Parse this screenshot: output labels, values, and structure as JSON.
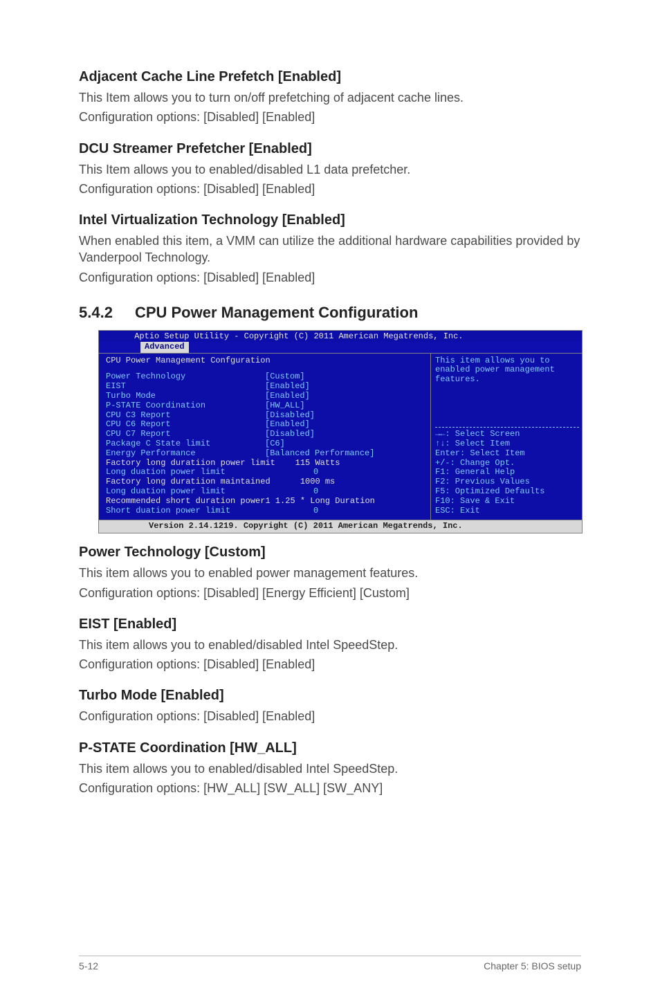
{
  "sections": {
    "adjacent": {
      "title": "Adjacent Cache Line Prefetch [Enabled]",
      "text1": "This Item allows you to turn on/off prefetching of adjacent cache lines.",
      "text2": "Configuration options: [Disabled] [Enabled]"
    },
    "dcu": {
      "title": "DCU Streamer Prefetcher [Enabled]",
      "text1": "This Item allows you to enabled/disabled L1 data prefetcher.",
      "text2": "Configuration options: [Disabled] [Enabled]"
    },
    "intelvt": {
      "title": "Intel Virtualization Technology [Enabled]",
      "text1": "When enabled this item, a VMM can utilize the additional hardware capabilities provided by Vanderpool Technology.",
      "text2": "Configuration options: [Disabled] [Enabled]"
    },
    "powertech": {
      "title": "Power Technology [Custom]",
      "text1": "This item allows you to enabled power management features.",
      "text2": "Configuration options: [Disabled] [Energy Efficient] [Custom]"
    },
    "eist": {
      "title": "EIST [Enabled]",
      "text1": "This item allows you to enabled/disabled Intel SpeedStep.",
      "text2": "Configuration options: [Disabled] [Enabled]"
    },
    "turbo": {
      "title": "Turbo Mode [Enabled]",
      "text1": "Configuration options: [Disabled] [Enabled]"
    },
    "pstate": {
      "title": "P-STATE Coordination [HW_ALL]",
      "text1": "This item allows you to enabled/disabled Intel SpeedStep.",
      "text2": "Configuration options: [HW_ALL] [SW_ALL] [SW_ANY]"
    }
  },
  "subsection": {
    "num": "5.4.2",
    "title": "CPU Power Management Configuration"
  },
  "bios": {
    "header": "Aptio Setup Utility - Copyright (C) 2011 American Megatrends, Inc.",
    "tab": "Advanced",
    "section_title": "CPU Power Management Confguration",
    "rows": [
      {
        "label": "Power Technology",
        "value": "[Custom]"
      },
      {
        "label": "EIST",
        "value": "[Enabled]"
      },
      {
        "label": "Turbo Mode",
        "value": "[Enabled]"
      },
      {
        "label": "P-STATE Coordination",
        "value": "[HW_ALL]"
      },
      {
        "label": "CPU C3 Report",
        "value": "[Disabled]"
      },
      {
        "label": "CPU C6 Report",
        "value": "[Enabled]"
      },
      {
        "label": "CPU C7 Report",
        "value": "[Disabled]"
      },
      {
        "label": "Package C State limit",
        "value": "[C6]"
      },
      {
        "label": "Energy Performance",
        "value": "[Balanced Performance]"
      }
    ],
    "wide1": "Factory long duratiion power limit    115 Watts",
    "long_duation_1_label": "Long duation power limit",
    "long_duation_1_value": "0",
    "wide2": "Factory long duratiion maintained      1000 ms",
    "long_duation_2_label": "Long duation power limit",
    "long_duation_2_value": "0",
    "wide3": "Recommended short duration power1 1.25 * Long Duration",
    "short_label": "Short duation power limit",
    "short_value": "0",
    "help": "This item allows you to enabled power management features.",
    "nav": [
      "→←: Select Screen",
      "↑↓:  Select Item",
      "Enter: Select Item",
      "+/-: Change Opt.",
      "F1: General Help",
      "F2: Previous Values",
      "F5: Optimized Defaults",
      "F10: Save & Exit",
      "ESC: Exit"
    ],
    "footer": "Version 2.14.1219. Copyright (C) 2011 American Megatrends, Inc."
  },
  "page_footer": {
    "left": "5-12",
    "right": "Chapter 5: BIOS setup"
  }
}
